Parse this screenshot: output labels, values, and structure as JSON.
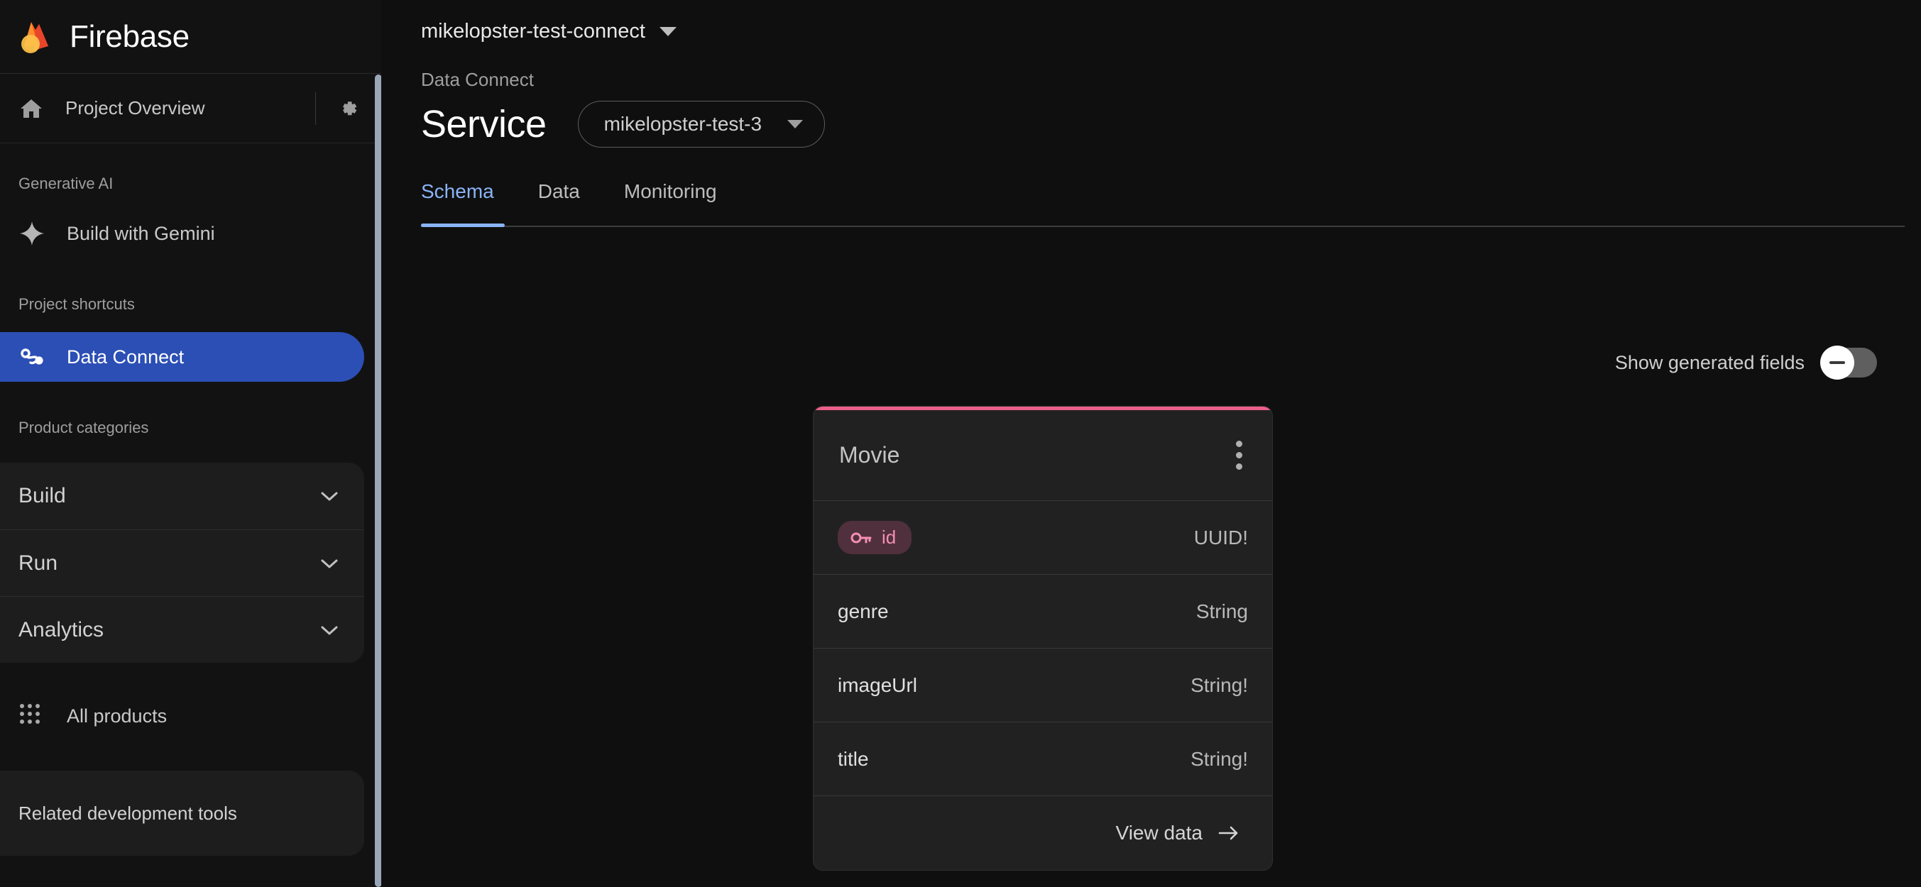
{
  "brand": {
    "name": "Firebase",
    "logo_colors": {
      "flame": "#f5500f",
      "flame_dark": "#e8452c",
      "amber": "#ffc24a"
    }
  },
  "sidebar": {
    "project_overview": "Project Overview",
    "settings_tooltip": "Settings",
    "sections": {
      "generative_ai": "Generative AI",
      "project_shortcuts": "Project shortcuts",
      "product_categories": "Product categories"
    },
    "gemini_item": "Build with Gemini",
    "active_item": "Data Connect",
    "active_color": "#2c4fb5",
    "categories": [
      {
        "label": "Build"
      },
      {
        "label": "Run"
      },
      {
        "label": "Analytics"
      }
    ],
    "all_products": "All products",
    "related_tools": "Related development tools"
  },
  "header": {
    "project_name": "mikelopster-test-connect",
    "breadcrumb": "Data Connect",
    "page_title": "Service",
    "service_selected": "mikelopster-test-3"
  },
  "tabs": [
    {
      "label": "Schema",
      "active": true
    },
    {
      "label": "Data",
      "active": false
    },
    {
      "label": "Monitoring",
      "active": false
    }
  ],
  "tab_accent": "#8ab4f8",
  "toolbar": {
    "generated_fields_label": "Show generated fields",
    "generated_fields_on": false
  },
  "entity": {
    "name": "Movie",
    "accent_color": "#ec5f8b",
    "menu_icon": "kebab-menu-icon",
    "fields": [
      {
        "name": "id",
        "type": "UUID!",
        "primary_key": true
      },
      {
        "name": "genre",
        "type": "String",
        "primary_key": false
      },
      {
        "name": "imageUrl",
        "type": "String!",
        "primary_key": false
      },
      {
        "name": "title",
        "type": "String!",
        "primary_key": false
      }
    ],
    "view_data_label": "View data"
  }
}
